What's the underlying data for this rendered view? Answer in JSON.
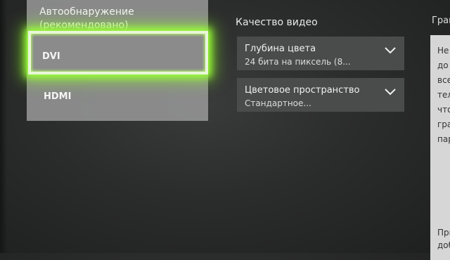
{
  "dropdown": {
    "options": [
      {
        "label_line1": "Автообнаружение",
        "label_line2": "(рекомендовано)"
      },
      {
        "label": "DVI",
        "selected": true
      },
      {
        "label": "HDMI"
      }
    ],
    "focus_color": "#9bff3a"
  },
  "video_quality": {
    "title": "Качество видео",
    "color_depth": {
      "label": "Глубина цвета",
      "value": "24 бита на пиксель (8..."
    },
    "color_space": {
      "label": "Цветовое пространство",
      "value": "Стандартное..."
    }
  },
  "right_panel": {
    "title": "Гран",
    "lines": [
      "Не",
      "до",
      "все",
      "тел",
      "что",
      "гра",
      "пар"
    ],
    "bottom_lines": [
      "При",
      "доба"
    ]
  }
}
